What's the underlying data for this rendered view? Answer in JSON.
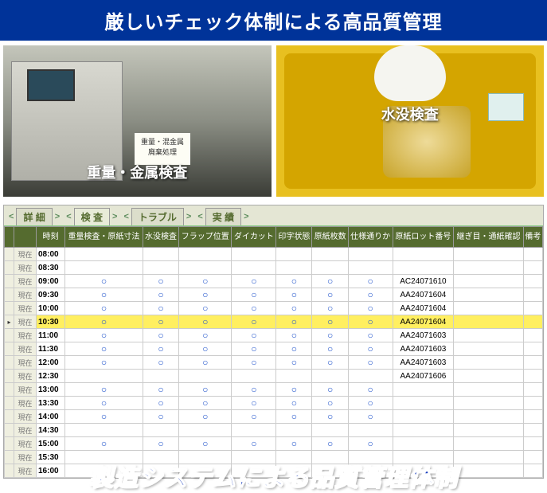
{
  "banner": "厳しいチェック体制による高品質管理",
  "photos": {
    "left_caption": "重量・金属検査",
    "left_sign_l1": "重量・混金属",
    "left_sign_l2": "廃棄処理",
    "right_caption": "水没検査"
  },
  "tabs": [
    "詳   細",
    "検   査",
    "トラブル",
    "実   績"
  ],
  "columns": [
    "",
    "",
    "時刻",
    "重量検査・原紙寸法",
    "水没検査",
    "フラップ位置",
    "ダイカット",
    "印字状態",
    "原紙枚数",
    "仕様通りか",
    "原紙ロット番号",
    "継ぎ目・通紙確認",
    "備考"
  ],
  "rowlabel": "現在",
  "rows": [
    {
      "time": "08:00",
      "checks": [
        0,
        0,
        0,
        0,
        0,
        0,
        0
      ],
      "lot": ""
    },
    {
      "time": "08:30",
      "checks": [
        0,
        0,
        0,
        0,
        0,
        0,
        0
      ],
      "lot": ""
    },
    {
      "time": "09:00",
      "checks": [
        1,
        1,
        1,
        1,
        1,
        1,
        1
      ],
      "lot": "AC24071610"
    },
    {
      "time": "09:30",
      "checks": [
        1,
        1,
        1,
        1,
        1,
        1,
        1
      ],
      "lot": "AA24071604"
    },
    {
      "time": "10:00",
      "checks": [
        1,
        1,
        1,
        1,
        1,
        1,
        1
      ],
      "lot": "AA24071604"
    },
    {
      "time": "10:30",
      "checks": [
        1,
        1,
        1,
        1,
        1,
        1,
        1
      ],
      "lot": "AA24071604",
      "hl": true,
      "sel": true
    },
    {
      "time": "11:00",
      "checks": [
        1,
        1,
        1,
        1,
        1,
        1,
        1
      ],
      "lot": "AA24071603"
    },
    {
      "time": "11:30",
      "checks": [
        1,
        1,
        1,
        1,
        1,
        1,
        1
      ],
      "lot": "AA24071603"
    },
    {
      "time": "12:00",
      "checks": [
        1,
        1,
        1,
        1,
        1,
        1,
        1
      ],
      "lot": "AA24071603"
    },
    {
      "time": "12:30",
      "checks": [
        0,
        0,
        0,
        0,
        0,
        0,
        0
      ],
      "lot": "AA24071606"
    },
    {
      "time": "13:00",
      "checks": [
        1,
        1,
        1,
        1,
        1,
        1,
        1
      ],
      "lot": ""
    },
    {
      "time": "13:30",
      "checks": [
        1,
        1,
        1,
        1,
        1,
        1,
        1
      ],
      "lot": ""
    },
    {
      "time": "14:00",
      "checks": [
        1,
        1,
        1,
        1,
        1,
        1,
        1
      ],
      "lot": ""
    },
    {
      "time": "14:30",
      "checks": [
        0,
        0,
        0,
        0,
        0,
        0,
        0
      ],
      "lot": ""
    },
    {
      "time": "15:00",
      "checks": [
        1,
        1,
        1,
        1,
        1,
        1,
        1
      ],
      "lot": ""
    },
    {
      "time": "15:30",
      "checks": [
        0,
        0,
        0,
        0,
        0,
        0,
        0
      ],
      "lot": ""
    },
    {
      "time": "16:00",
      "checks": [
        0,
        0,
        0,
        0,
        0,
        0,
        0
      ],
      "lot": ""
    }
  ],
  "footer": "製造システムによる品質管理体制",
  "circle": "○",
  "nav_prev": "<",
  "nav_next": ">"
}
